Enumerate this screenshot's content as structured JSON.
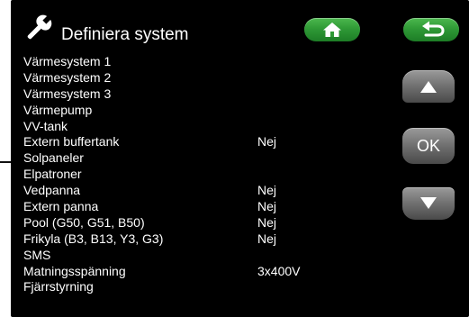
{
  "header": {
    "title": "Definiera system",
    "icon": "wrench-icon"
  },
  "buttons": {
    "home": "home-icon",
    "back": "back-arrow-icon",
    "up": "up-arrow-icon",
    "ok_label": "OK",
    "down": "down-arrow-icon"
  },
  "colors": {
    "background": "#000000",
    "text": "#ffffff",
    "green_button": "#2f9a36",
    "gray_button": "#6f6f6f"
  },
  "rows": [
    {
      "label": "Värmesystem 1",
      "value": ""
    },
    {
      "label": "Värmesystem 2",
      "value": ""
    },
    {
      "label": "Värmesystem 3",
      "value": ""
    },
    {
      "label": "Värmepump",
      "value": ""
    },
    {
      "label": "VV-tank",
      "value": ""
    },
    {
      "label": "Extern buffertank",
      "value": "Nej"
    },
    {
      "label": "Solpaneler",
      "value": ""
    },
    {
      "label": "Elpatroner",
      "value": ""
    },
    {
      "label": "Vedpanna",
      "value": "Nej"
    },
    {
      "label": "Extern panna",
      "value": "Nej"
    },
    {
      "label": "Pool (G50, G51, B50)",
      "value": "Nej"
    },
    {
      "label": "Frikyla (B3, B13, Y3, G3)",
      "value": "Nej"
    },
    {
      "label": "SMS",
      "value": ""
    },
    {
      "label": "Matningsspänning",
      "value": "3x400V"
    },
    {
      "label": "Fjärrstyrning",
      "value": ""
    }
  ]
}
